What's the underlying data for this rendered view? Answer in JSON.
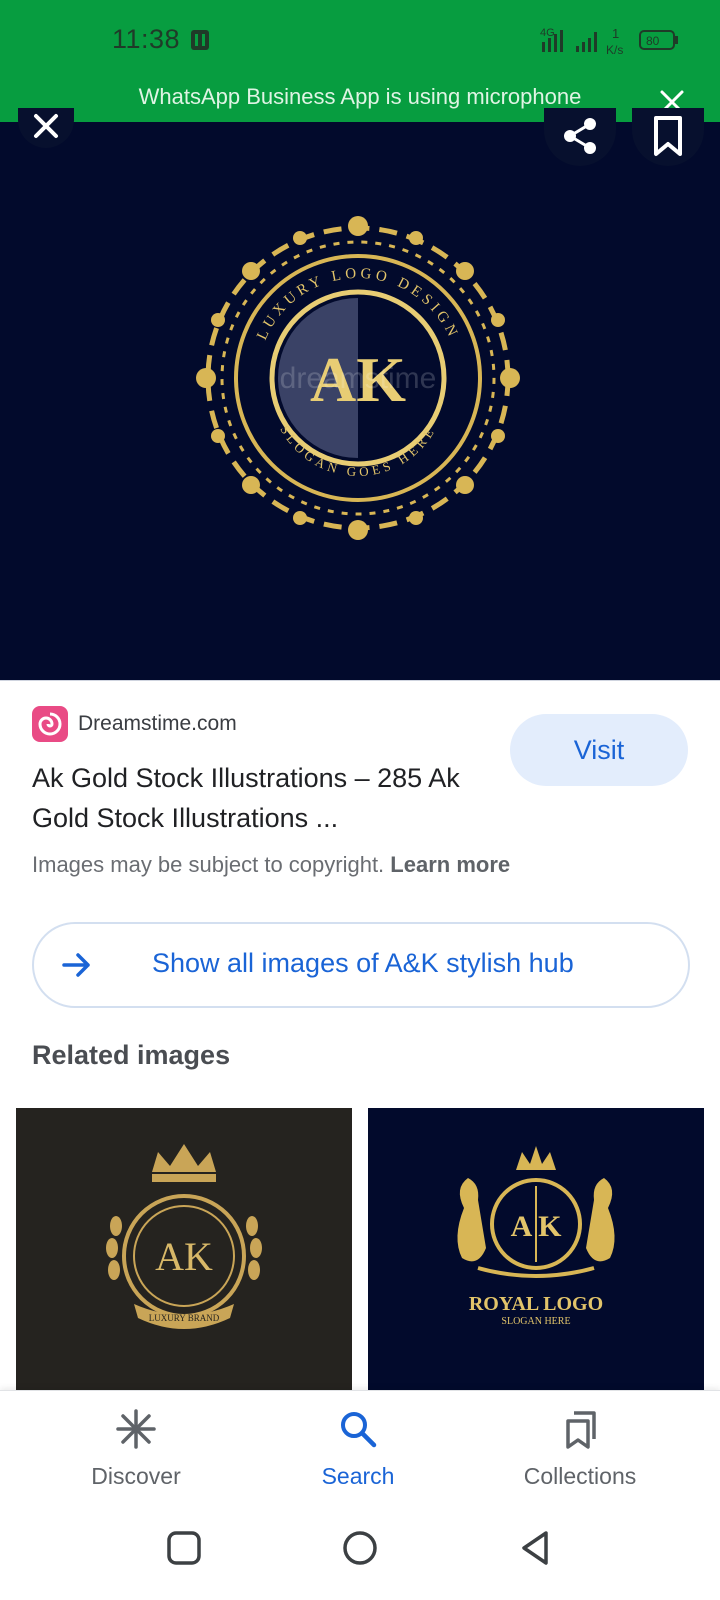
{
  "status_bar": {
    "time": "11:38",
    "network_label": "4G",
    "speed_value": "1",
    "speed_unit": "K/s",
    "battery": "80"
  },
  "notification": {
    "text": "WhatsApp Business App is using microphone"
  },
  "hero": {
    "logo_top_text": "LUXURY LOGO DESIGN",
    "logo_bottom_text": "SLOGAN GOES HERE",
    "logo_letters": "AK",
    "watermark": "dreamstime",
    "colors": {
      "background": "#020a2c",
      "gold": "#d8b655"
    }
  },
  "result": {
    "source_name": "Dreamstime.com",
    "title": "Ak Gold Stock Illustrations – 285 Ak Gold Stock Illustrations ...",
    "visit_label": "Visit",
    "copyright_text": "Images may be subject to copyright.",
    "learn_more": "Learn more"
  },
  "show_all": {
    "label": "Show all images of A&K stylish hub"
  },
  "related": {
    "title": "Related images",
    "items": [
      {
        "letters": "AK",
        "ribbon": "LUXURY BRAND",
        "bg": "#25231f"
      },
      {
        "letters": "A K",
        "line1": "ROYAL LOGO",
        "line2": "SLOGAN HERE",
        "bg": "#020a2c"
      }
    ]
  },
  "bottom_nav": {
    "items": [
      {
        "label": "Discover",
        "icon": "asterisk-icon",
        "active": false
      },
      {
        "label": "Search",
        "icon": "search-icon",
        "active": true
      },
      {
        "label": "Collections",
        "icon": "collections-icon",
        "active": false
      }
    ],
    "active_color": "#1a64d6"
  },
  "system_nav": {
    "buttons": [
      "recents-square-icon",
      "home-circle-icon",
      "back-triangle-icon"
    ]
  }
}
